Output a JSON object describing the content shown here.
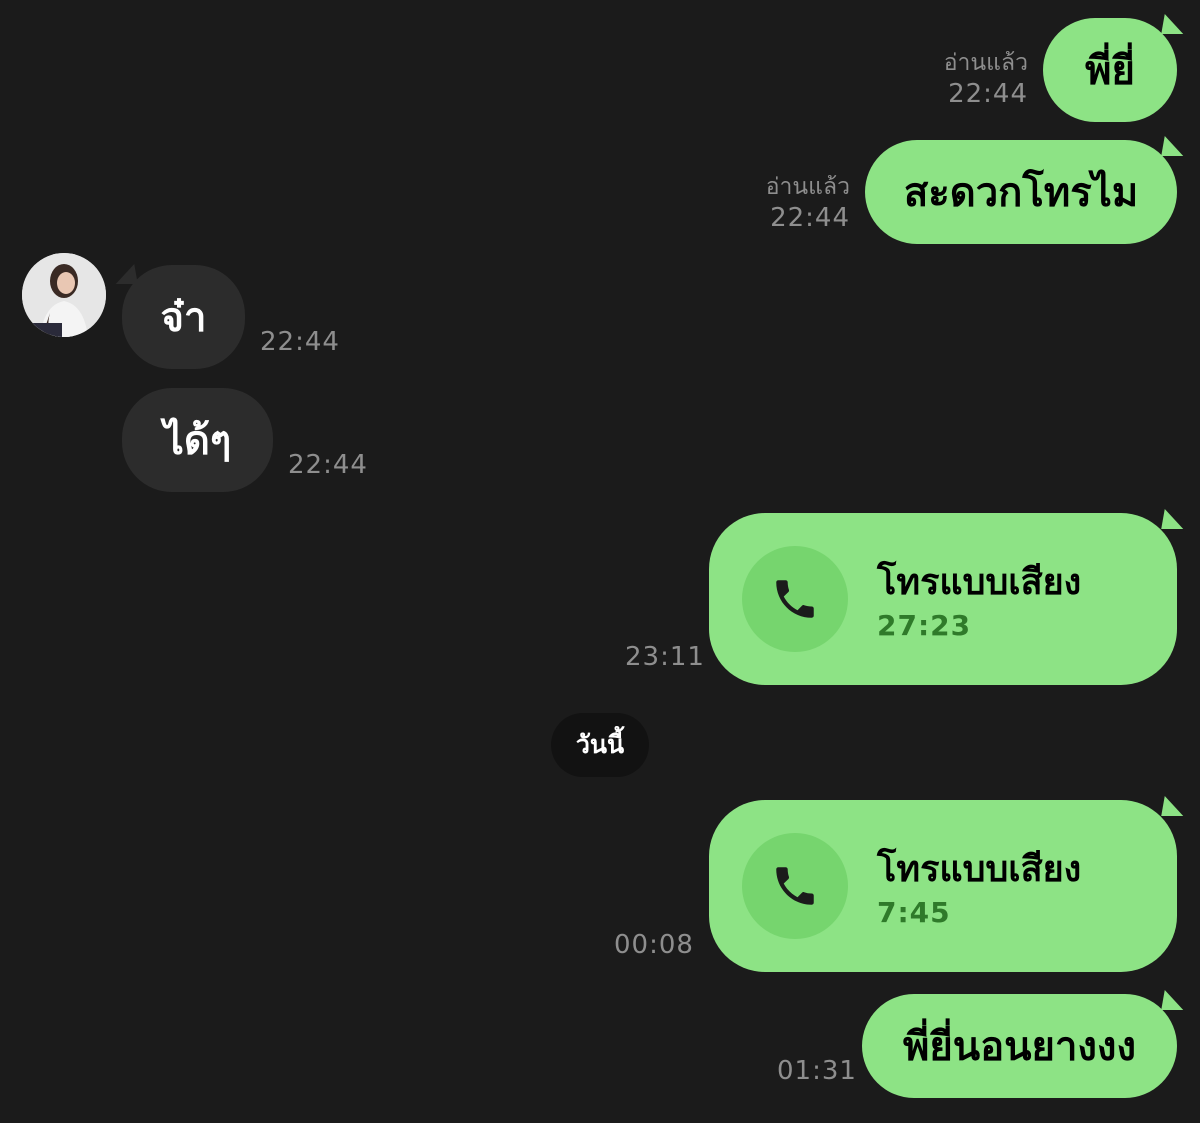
{
  "messages": [
    {
      "side": "out",
      "text": "พี่ยี่",
      "read": "อ่านแล้ว",
      "time": "22:44"
    },
    {
      "side": "out",
      "text": "สะดวกโทรไม",
      "read": "อ่านแล้ว",
      "time": "22:44"
    },
    {
      "side": "in",
      "text": "จ๋า",
      "time": "22:44"
    },
    {
      "side": "in",
      "text": "ได้ๆ",
      "time": "22:44"
    },
    {
      "side": "out",
      "type": "call",
      "title": "โทรแบบเสียง",
      "duration": "27:23",
      "time": "23:11"
    },
    {
      "side": "out",
      "type": "call",
      "title": "โทรแบบเสียง",
      "duration": "7:45",
      "time": "00:08"
    },
    {
      "side": "out",
      "text": "พี่ยี่นอนยางงง",
      "time": "01:31"
    }
  ],
  "date_separator": "วันนี้",
  "icons": {
    "call": "phone-icon",
    "avatar": "contact-avatar"
  },
  "colors": {
    "background": "#1b1b1b",
    "outgoing_bubble": "#8de385",
    "incoming_bubble": "#2c2c2c",
    "meta_text": "#8e8e8e",
    "call_duration": "#2f7a2a"
  }
}
